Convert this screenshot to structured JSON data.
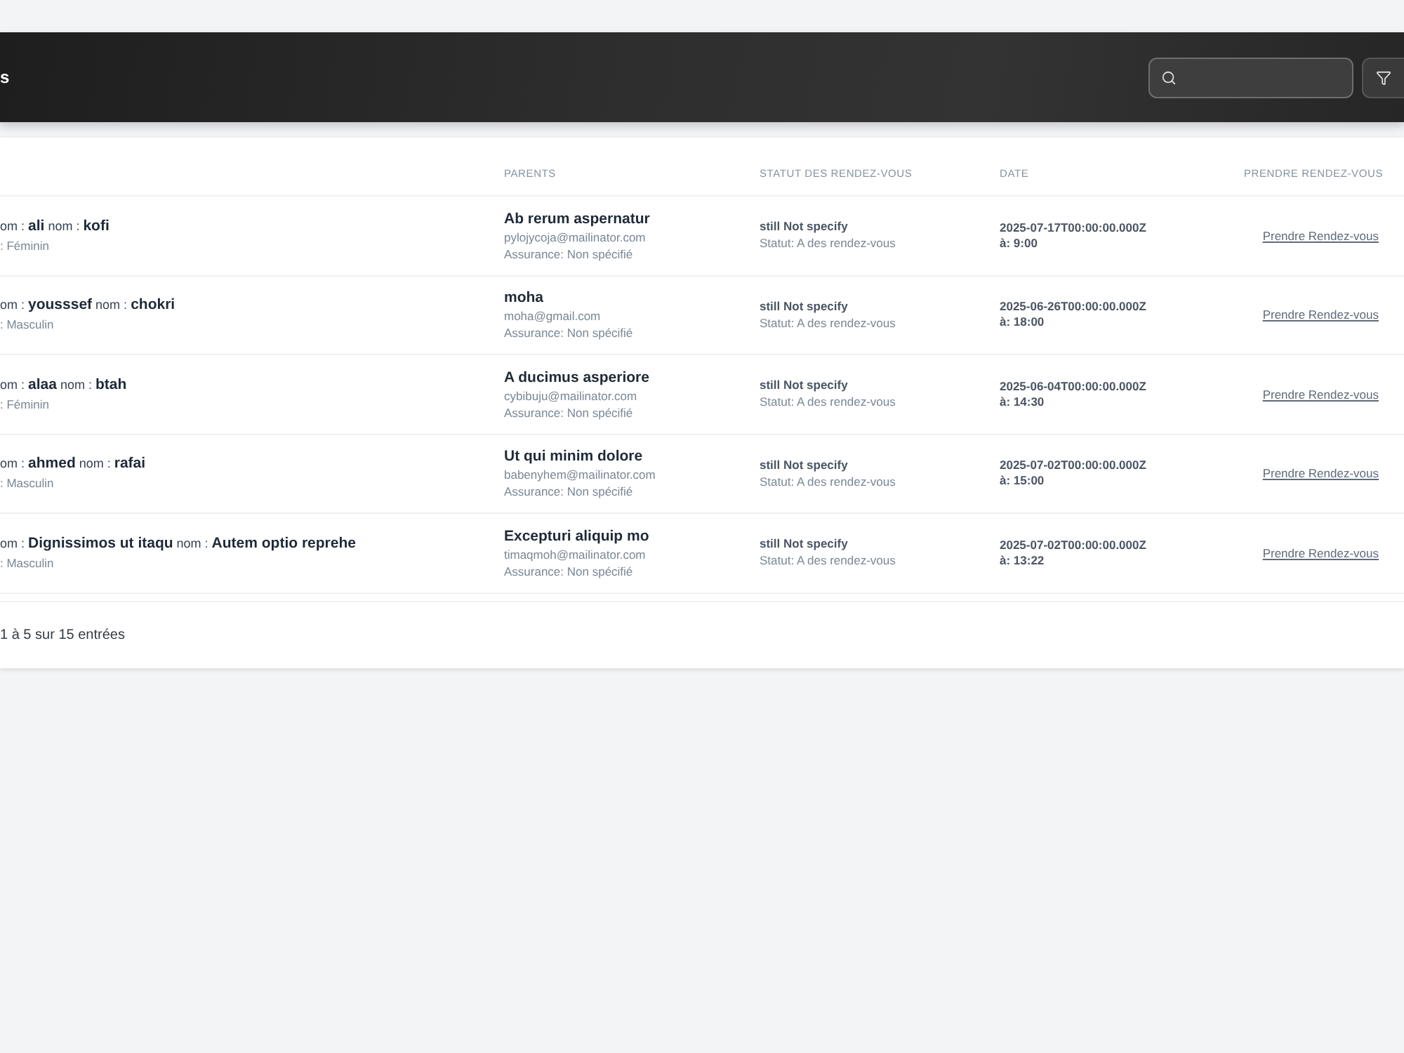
{
  "header": {
    "title": "s"
  },
  "table": {
    "columns": [
      "PARENTS",
      "STATUT DES RENDEZ-VOUS",
      "DATE",
      "PRENDRE RENDEZ-VOUS"
    ],
    "rows": [
      {
        "name": "om : **ali** nom : **kofi**",
        "gender": ": Féminin",
        "parent": {
          "name": "Ab rerum aspernatur",
          "email": "pylojycoja@mailinator.com",
          "insurance": "Assurance: Non spécifié"
        },
        "status": {
          "title": "still Not specify",
          "detail": "Statut: A des rendez-vous"
        },
        "date": {
          "value": "2025-07-17T00:00:00.000Z",
          "time": "à: 9:00"
        },
        "action": "Prendre Rendez-vous"
      },
      {
        "name": "om : **yousssef** nom : **chokri**",
        "gender": ": Masculin",
        "parent": {
          "name": "moha",
          "email": "moha@gmail.com",
          "insurance": "Assurance: Non spécifié"
        },
        "status": {
          "title": "still Not specify",
          "detail": "Statut: A des rendez-vous"
        },
        "date": {
          "value": "2025-06-26T00:00:00.000Z",
          "time": "à: 18:00"
        },
        "action": "Prendre Rendez-vous"
      },
      {
        "name": "om : **alaa** nom : **btah**",
        "gender": ": Féminin",
        "parent": {
          "name": "A ducimus asperiore",
          "email": "cybibuju@mailinator.com",
          "insurance": "Assurance: Non spécifié"
        },
        "status": {
          "title": "still Not specify",
          "detail": "Statut: A des rendez-vous"
        },
        "date": {
          "value": "2025-06-04T00:00:00.000Z",
          "time": "à: 14:30"
        },
        "action": "Prendre Rendez-vous"
      },
      {
        "name": "om : **ahmed** nom : **rafai**",
        "gender": ": Masculin",
        "parent": {
          "name": "Ut qui minim dolore",
          "email": "babenyhem@mailinator.com",
          "insurance": "Assurance: Non spécifié"
        },
        "status": {
          "title": "still Not specify",
          "detail": "Statut: A des rendez-vous"
        },
        "date": {
          "value": "2025-07-02T00:00:00.000Z",
          "time": "à: 15:00"
        },
        "action": "Prendre Rendez-vous"
      },
      {
        "name": "om : **Dignissimos ut itaqu** nom : **Autem optio reprehe**",
        "gender": ": Masculin",
        "parent": {
          "name": "Excepturi aliquip mo",
          "email": "timaqmoh@mailinator.com",
          "insurance": "Assurance: Non spécifié"
        },
        "status": {
          "title": "still Not specify",
          "detail": "Statut: A des rendez-vous"
        },
        "date": {
          "value": "2025-07-02T00:00:00.000Z",
          "time": "à: 13:22"
        },
        "action": "Prendre Rendez-vous"
      }
    ]
  },
  "footer": {
    "info": "1 à 5 sur 15 entrées"
  }
}
